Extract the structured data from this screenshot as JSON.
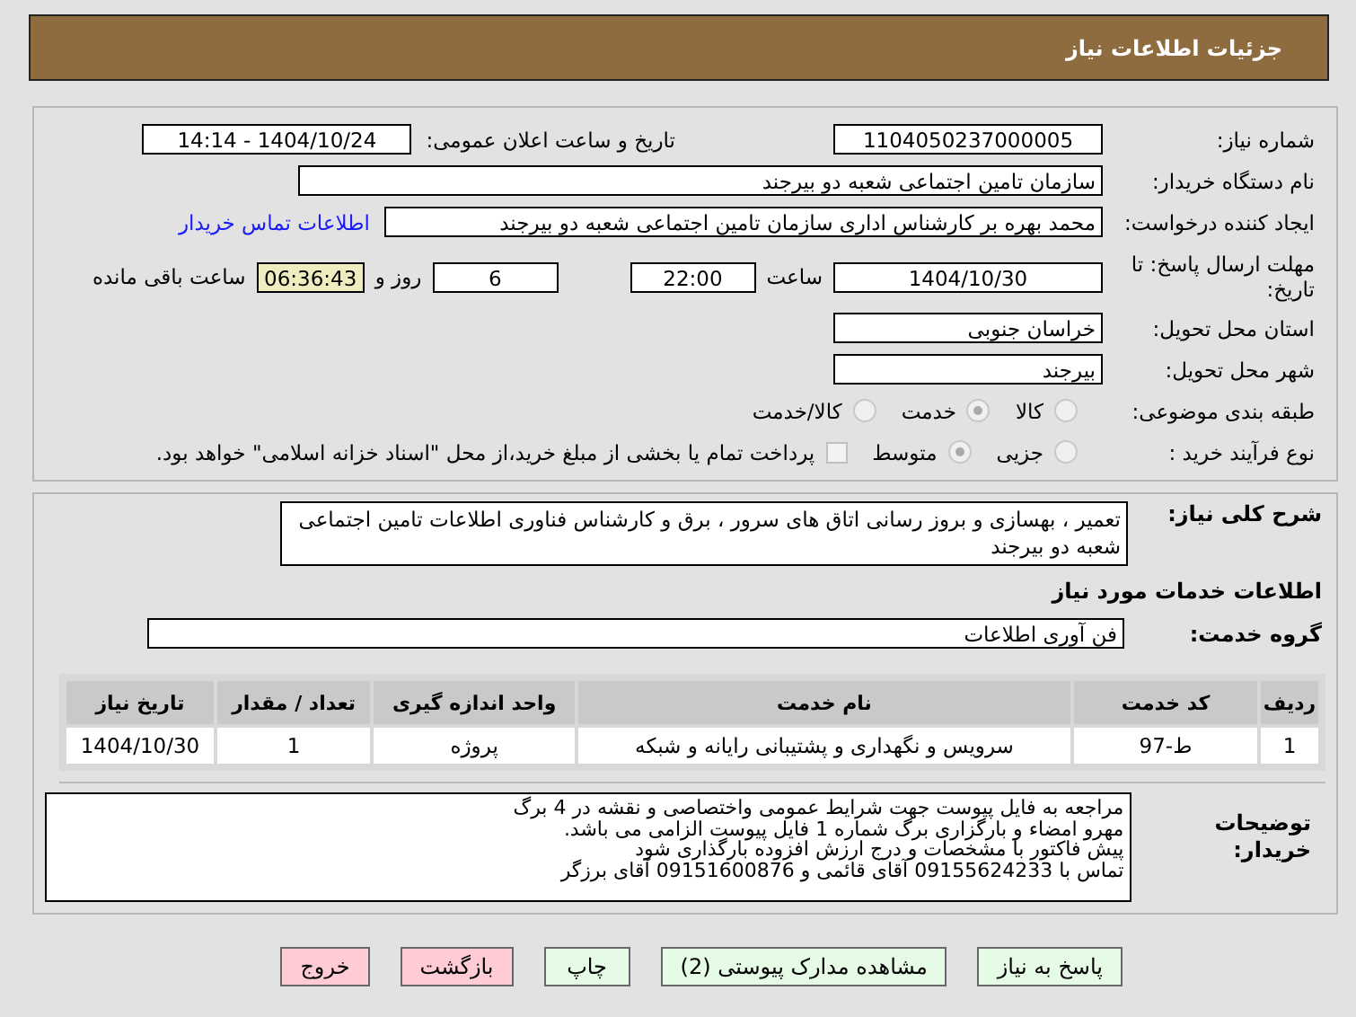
{
  "title": "جزئیات اطلاعات نیاز",
  "need_number": {
    "label": "شماره نیاز:",
    "value": "1104050237000005"
  },
  "announce": {
    "label": "تاریخ و ساعت اعلان عمومی:",
    "value": "1404/10/24 - 14:14"
  },
  "buyer": {
    "label": "نام دستگاه خریدار:",
    "value": "سازمان تامین اجتماعی شعبه دو بیرجند"
  },
  "creator": {
    "label": "ایجاد کننده درخواست:",
    "value": "محمد بهره بر کارشناس اداری سازمان تامین اجتماعی شعبه دو بیرجند",
    "link": "اطلاعات تماس خریدار"
  },
  "deadline": {
    "label": "مهلت ارسال پاسخ: تا تاریخ:",
    "date": "1404/10/30",
    "time_label": "ساعت",
    "time": "22:00",
    "days": "6",
    "days_label": "روز و",
    "remaining": "06:36:43",
    "remaining_label": "ساعت باقی مانده"
  },
  "province": {
    "label": "استان محل تحویل:",
    "value": "خراسان جنوبی"
  },
  "city": {
    "label": "شهر محل تحویل:",
    "value": "بیرجند"
  },
  "category": {
    "label": "طبقه بندی موضوعی:",
    "options": [
      {
        "label": "کالا",
        "selected": false
      },
      {
        "label": "خدمت",
        "selected": true
      },
      {
        "label": "کالا/خدمت",
        "selected": false
      }
    ]
  },
  "process": {
    "label": "نوع فرآیند خرید :",
    "options": [
      {
        "label": "جزیی",
        "selected": false
      },
      {
        "label": "متوسط",
        "selected": true
      }
    ],
    "payment": {
      "checked": false,
      "text": "پرداخت تمام یا بخشی از مبلغ خرید،از محل \"اسناد خزانه اسلامی\" خواهد بود."
    }
  },
  "description": {
    "label": "شرح کلی نیاز:",
    "value": "تعمیر ، بهسازی و بروز رسانی اتاق های سرور ، برق و کارشناس فناوری اطلاعات تامین اجتماعی شعبه دو بیرجند"
  },
  "services_heading": "اطلاعات خدمات مورد نیاز",
  "service_group": {
    "label": "گروه خدمت:",
    "value": "فن آوری اطلاعات"
  },
  "table": {
    "columns": [
      "ردیف",
      "کد خدمت",
      "نام خدمت",
      "واحد اندازه گیری",
      "تعداد / مقدار",
      "تاریخ نیاز"
    ],
    "rows": [
      [
        "1",
        "ط-97",
        "سرویس و نگهداری و پشتیبانی رایانه و شبکه",
        "پروژه",
        "1",
        "1404/10/30"
      ]
    ]
  },
  "buyer_notes": {
    "label": "توضیحات خریدار:",
    "lines": [
      "مراجعه به فایل پیوست  جهت شرایط عمومی واختصاصی و نقشه در 4 برگ",
      "مهرو امضاء و بارگزاری  برگ شماره 1 فایل پیوست الزامی می باشد.",
      "پیش فاکتور با مشخصات و درج ارزش افزوده بارگذاری شود",
      " تماس با 09155624233 آقای قائمی و 09151600876 آقای برزگر"
    ]
  },
  "buttons": [
    {
      "label": "پاسخ به نیاز",
      "kind": "action"
    },
    {
      "label": "مشاهده مدارک پیوستی (2)",
      "kind": "action"
    },
    {
      "label": "چاپ",
      "kind": "action"
    },
    {
      "label": "بازگشت",
      "kind": "exit"
    },
    {
      "label": "خروج",
      "kind": "exit"
    }
  ]
}
